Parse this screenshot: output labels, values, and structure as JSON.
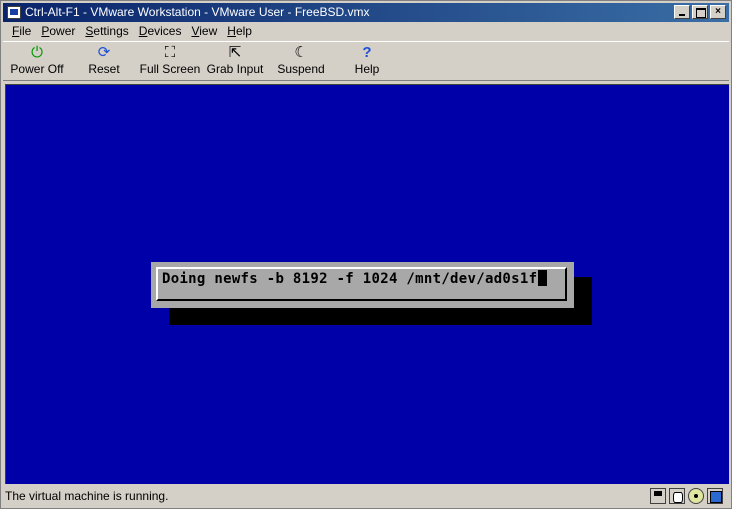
{
  "window": {
    "title": "Ctrl-Alt-F1 - VMware Workstation - VMware User - FreeBSD.vmx",
    "buttons": {
      "minimize": "_",
      "maximize": "□",
      "close": "×"
    }
  },
  "menu": [
    {
      "label": "File",
      "underline": "F",
      "rest": "ile"
    },
    {
      "label": "Power",
      "underline": "P",
      "rest": "ower"
    },
    {
      "label": "Settings",
      "underline": "S",
      "rest": "ettings"
    },
    {
      "label": "Devices",
      "underline": "D",
      "rest": "evices"
    },
    {
      "label": "View",
      "underline": "V",
      "rest": "iew"
    },
    {
      "label": "Help",
      "underline": "H",
      "rest": "elp"
    }
  ],
  "toolbar": {
    "power_off": {
      "label": "Power Off",
      "icon": "⏻",
      "icon_name": "power-icon",
      "color": "#009900"
    },
    "reset": {
      "label": "Reset",
      "icon": "⟳",
      "icon_name": "reset-icon",
      "color": "#1e4fd6"
    },
    "full_screen": {
      "label": "Full Screen",
      "icon": "⛶",
      "icon_name": "full-screen-icon",
      "color": "#000000"
    },
    "grab_input": {
      "label": "Grab Input",
      "icon": "⇱",
      "icon_name": "grab-input-icon",
      "color": "#000000"
    },
    "suspend": {
      "label": "Suspend",
      "icon": "☾",
      "icon_name": "suspend-icon",
      "color": "#000000"
    },
    "help": {
      "label": "Help",
      "icon": "?",
      "icon_name": "help-icon",
      "color": "#1e4fd6"
    }
  },
  "guest": {
    "background": "#0000a8",
    "dialog_text": "Doing newfs -b 8192 -f 1024 /mnt/dev/ad0s1f"
  },
  "status": {
    "text": "The virtual machine is running.",
    "icons": [
      "floppy-icon",
      "hard-disk-icon",
      "cdrom-icon",
      "network-icon"
    ]
  }
}
